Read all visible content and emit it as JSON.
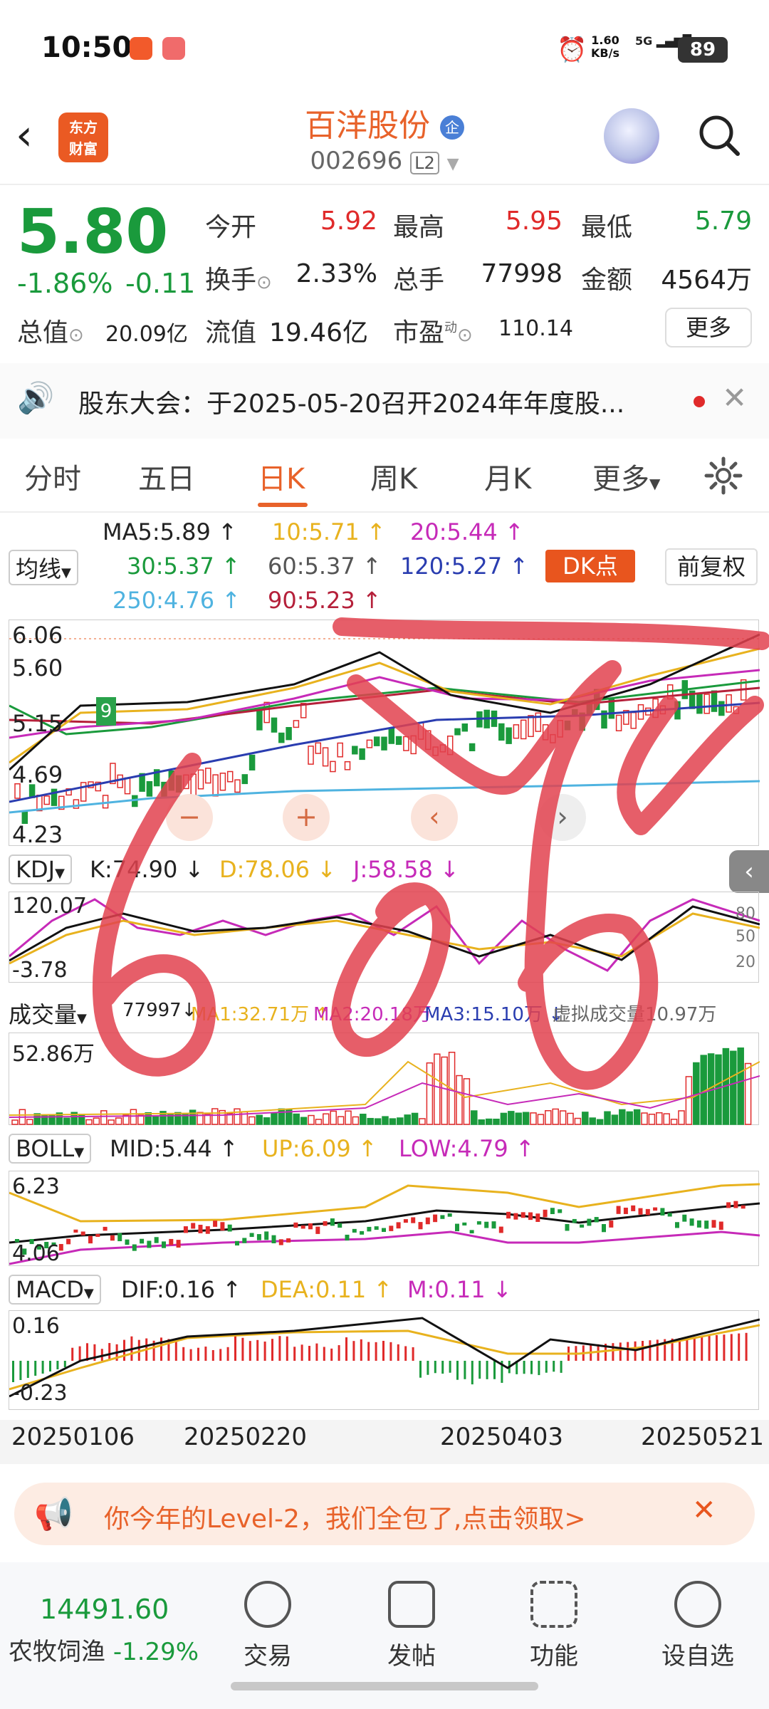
{
  "status_bar": {
    "time": "10:50",
    "speed_value": "1.60",
    "speed_unit": "KB/s",
    "network": "5G",
    "battery": "89"
  },
  "header": {
    "app_logo_line1": "东方",
    "app_logo_line2": "财富",
    "stock_name": "百洋股份",
    "stock_badge": "企",
    "stock_code": "002696",
    "level_badge": "L2"
  },
  "quote": {
    "price": "5.80",
    "change_pct": "-1.86%",
    "change_abs": "-0.11",
    "open_label": "今开",
    "open": "5.92",
    "high_label": "最高",
    "high": "5.95",
    "low_label": "最低",
    "low": "5.79",
    "turnover_label": "换手",
    "turnover": "2.33%",
    "volume_label": "总手",
    "volume": "77998",
    "amount_label": "金额",
    "amount": "4564万",
    "mcap_label": "总值",
    "mcap": "20.09亿",
    "float_label": "流值",
    "float": "19.46亿",
    "pe_label": "市盈",
    "pe_sup": "动",
    "pe": "110.14",
    "more_button": "更多"
  },
  "notice": {
    "text": "股东大会：于2025-05-20召开2024年年度股..."
  },
  "tabs": [
    {
      "label": "分时"
    },
    {
      "label": "五日"
    },
    {
      "label": "日K"
    },
    {
      "label": "周K"
    },
    {
      "label": "月K"
    },
    {
      "label": "更多"
    }
  ],
  "ma_legend": {
    "selector": "均线",
    "ma5": "MA5:5.89 ↑",
    "ma10": "10:5.71 ↑",
    "ma20": "20:5.44 ↑",
    "ma30": "30:5.37 ↑",
    "ma60": "60:5.37 ↑",
    "ma120": "120:5.27 ↑",
    "ma250": "250:4.76 ↑",
    "ma90": "90:5.23 ↑",
    "dk_button": "DK点",
    "adjust_button": "前复权"
  },
  "kchart": {
    "y_top": "6.06",
    "y_2": "5.60",
    "y_3": "5.15",
    "y_4": "4.69",
    "y_bottom": "4.23",
    "marker": "9"
  },
  "kdj": {
    "selector": "KDJ",
    "k": "K:74.90 ↓",
    "d": "D:78.06 ↓",
    "j": "J:58.58 ↓",
    "y_top": "120.07",
    "y_bottom": "-3.78",
    "r80": "80",
    "r50": "50",
    "r20": "20"
  },
  "volume": {
    "selector": "成交量",
    "vol": "77997↓",
    "ma1": "MA1:32.71万 ↑",
    "ma2": "MA2:20.18万",
    "ma3": "MA3:15.10万 ↓",
    "virtual": "虚拟成交量10.97万",
    "y_top": "52.86万"
  },
  "boll": {
    "selector": "BOLL",
    "mid": "MID:5.44 ↑",
    "up": "UP:6.09 ↑",
    "low": "LOW:4.79 ↑",
    "y_top": "6.23",
    "y_bottom": "4.06"
  },
  "macd": {
    "selector": "MACD",
    "dif": "DIF:0.16 ↑",
    "dea": "DEA:0.11 ↑",
    "m": "M:0.11 ↓",
    "y_top": "0.16",
    "y_bottom": "-0.23"
  },
  "dates": [
    "20250106",
    "20250220",
    "20250403",
    "20250521"
  ],
  "banner": {
    "text": "你今年的Level-2，我们全包了,点击领取>"
  },
  "bottom_nav": {
    "index_value": "14491.60",
    "index_name": "农牧饲渔",
    "index_change": "-1.29%",
    "items": [
      {
        "label": "交易"
      },
      {
        "label": "发帖"
      },
      {
        "label": "功能"
      },
      {
        "label": "设自选"
      }
    ]
  },
  "colors": {
    "up": "#e02a2a",
    "down": "#1a9a3c",
    "accent": "#e8622a",
    "ma10": "#e8b21e",
    "ma20": "#c62ab8",
    "ma120": "#2a3db0",
    "ma250": "#4fb3e0",
    "ma90": "#b5203a"
  }
}
